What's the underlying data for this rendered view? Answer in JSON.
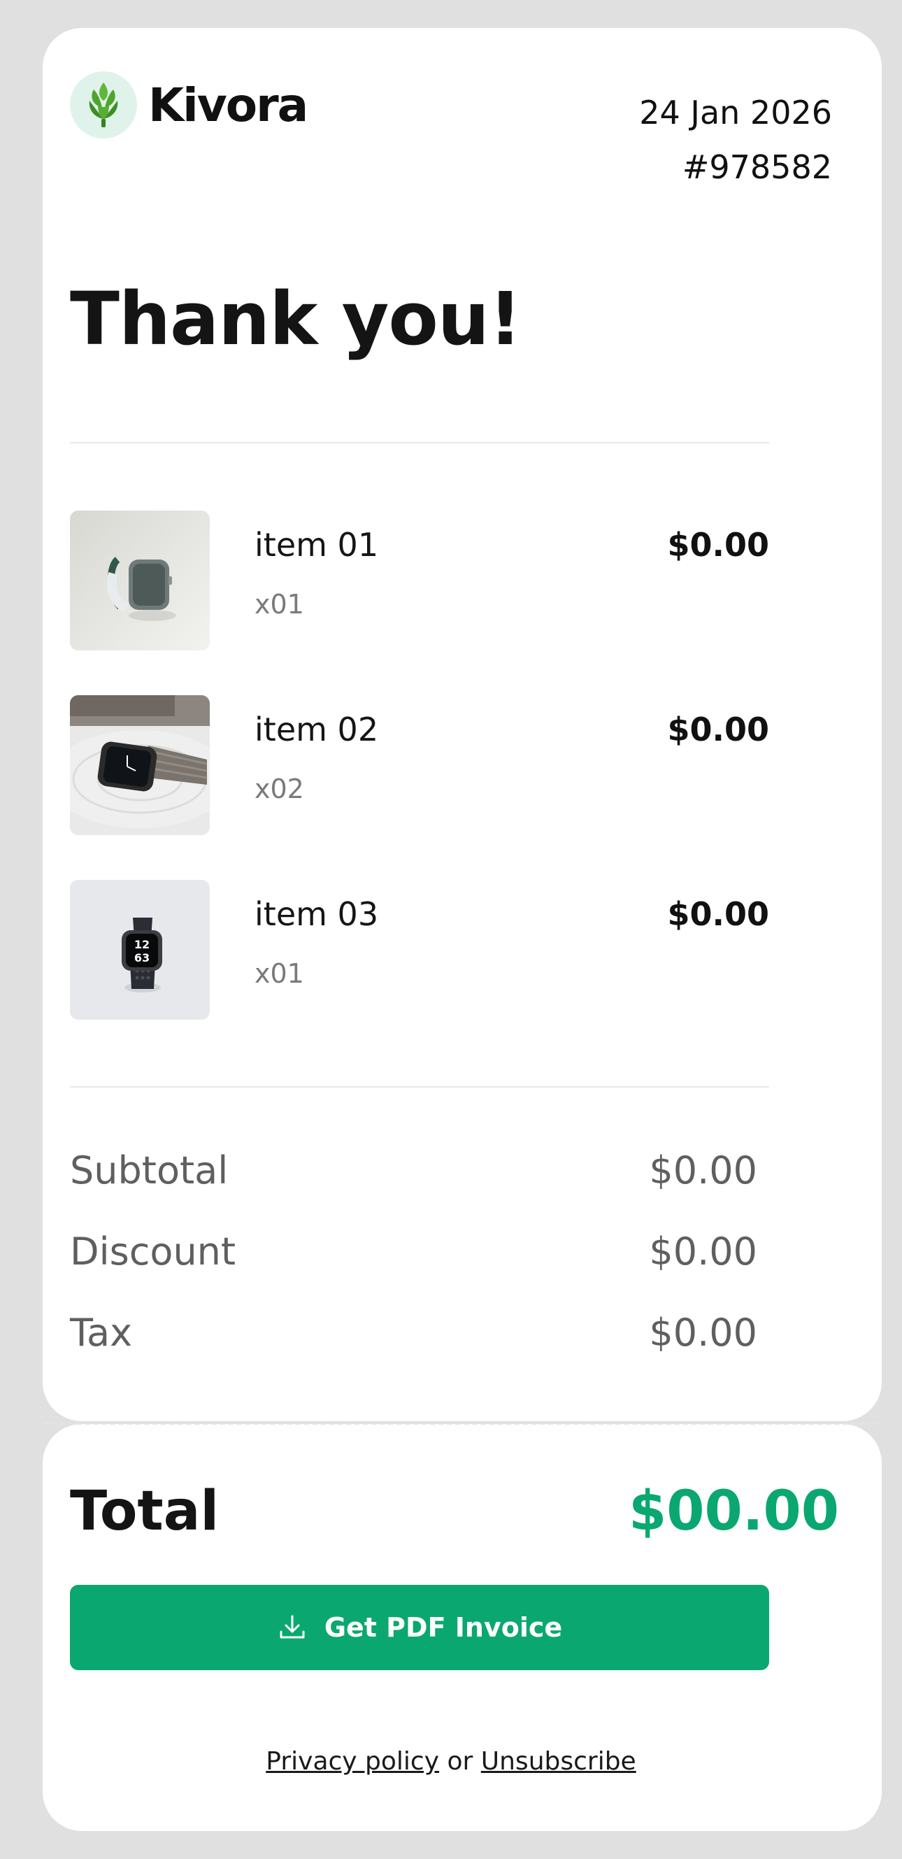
{
  "colors": {
    "page_background": "#e0e0e0",
    "card": "#ffffff",
    "accent": "#0aa870",
    "logo_badge": "#dff3ea"
  },
  "header": {
    "brand": "Kivora",
    "logo_icon": "artichoke-icon",
    "date": "24 Jan 2026",
    "order_number": "#978582"
  },
  "heading": "Thank you!",
  "items": [
    {
      "name": "item 01",
      "qty": "x01",
      "price": "$0.00",
      "image": "smartwatch-white-band-photo"
    },
    {
      "name": "item 02",
      "qty": "x02",
      "price": "$0.00",
      "image": "smartwatch-grey-loop-photo"
    },
    {
      "name": "item 03",
      "qty": "x01",
      "price": "$0.00",
      "image": "smartwatch-black-sport-photo"
    }
  ],
  "summary": {
    "subtotal_label": "Subtotal",
    "subtotal_value": "$0.00",
    "discount_label": "Discount",
    "discount_value": "$0.00",
    "tax_label": "Tax",
    "tax_value": "$0.00"
  },
  "total": {
    "label": "Total",
    "value": "$00.00"
  },
  "pdf_button": {
    "label": "Get PDF Invoice",
    "icon": "download-icon"
  },
  "footer": {
    "privacy": "Privacy policy",
    "separator": "or",
    "unsubscribe": "Unsubscribe"
  }
}
